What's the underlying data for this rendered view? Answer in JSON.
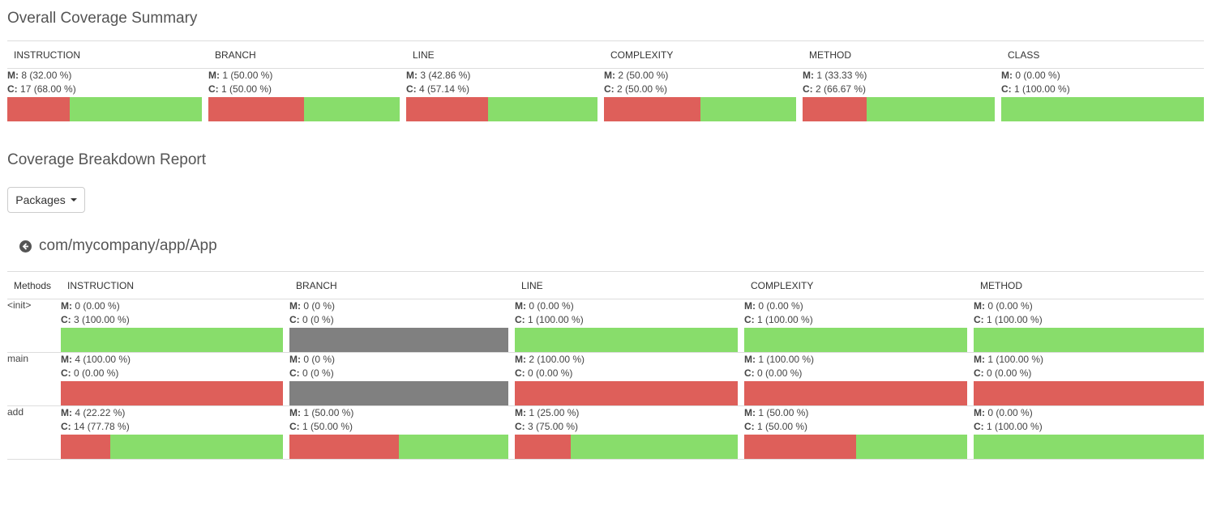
{
  "summary": {
    "title": "Overall Coverage Summary",
    "headers": [
      "INSTRUCTION",
      "BRANCH",
      "LINE",
      "COMPLEXITY",
      "METHOD",
      "CLASS"
    ],
    "cells": [
      {
        "m": "8 (32.00 %)",
        "c": "17 (68.00 %)",
        "missed_fraction": 0.32,
        "empty": false
      },
      {
        "m": "1 (50.00 %)",
        "c": "1 (50.00 %)",
        "missed_fraction": 0.5,
        "empty": false
      },
      {
        "m": "3 (42.86 %)",
        "c": "4 (57.14 %)",
        "missed_fraction": 0.4286,
        "empty": false
      },
      {
        "m": "2 (50.00 %)",
        "c": "2 (50.00 %)",
        "missed_fraction": 0.5,
        "empty": false
      },
      {
        "m": "1 (33.33 %)",
        "c": "2 (66.67 %)",
        "missed_fraction": 0.3333,
        "empty": false
      },
      {
        "m": "0 (0.00 %)",
        "c": "1 (100.00 %)",
        "missed_fraction": 0.0,
        "empty": false
      }
    ]
  },
  "breakdown": {
    "title": "Coverage Breakdown Report",
    "dropdown_label": "Packages",
    "package_name": "com/mycompany/app/App",
    "methods_header": "Methods",
    "headers": [
      "INSTRUCTION",
      "BRANCH",
      "LINE",
      "COMPLEXITY",
      "METHOD"
    ],
    "rows": [
      {
        "name": "<init>",
        "cells": [
          {
            "m": "0 (0.00 %)",
            "c": "3 (100.00 %)",
            "missed_fraction": 0.0,
            "empty": false
          },
          {
            "m": "0 (0 %)",
            "c": "0 (0 %)",
            "missed_fraction": 0.0,
            "empty": true
          },
          {
            "m": "0 (0.00 %)",
            "c": "1 (100.00 %)",
            "missed_fraction": 0.0,
            "empty": false
          },
          {
            "m": "0 (0.00 %)",
            "c": "1 (100.00 %)",
            "missed_fraction": 0.0,
            "empty": false
          },
          {
            "m": "0 (0.00 %)",
            "c": "1 (100.00 %)",
            "missed_fraction": 0.0,
            "empty": false
          }
        ]
      },
      {
        "name": "main",
        "cells": [
          {
            "m": "4 (100.00 %)",
            "c": "0 (0.00 %)",
            "missed_fraction": 1.0,
            "empty": false
          },
          {
            "m": "0 (0 %)",
            "c": "0 (0 %)",
            "missed_fraction": 0.0,
            "empty": true
          },
          {
            "m": "2 (100.00 %)",
            "c": "0 (0.00 %)",
            "missed_fraction": 1.0,
            "empty": false
          },
          {
            "m": "1 (100.00 %)",
            "c": "0 (0.00 %)",
            "missed_fraction": 1.0,
            "empty": false
          },
          {
            "m": "1 (100.00 %)",
            "c": "0 (0.00 %)",
            "missed_fraction": 1.0,
            "empty": false
          }
        ]
      },
      {
        "name": "add",
        "cells": [
          {
            "m": "4 (22.22 %)",
            "c": "14 (77.78 %)",
            "missed_fraction": 0.2222,
            "empty": false
          },
          {
            "m": "1 (50.00 %)",
            "c": "1 (50.00 %)",
            "missed_fraction": 0.5,
            "empty": false
          },
          {
            "m": "1 (25.00 %)",
            "c": "3 (75.00 %)",
            "missed_fraction": 0.25,
            "empty": false
          },
          {
            "m": "1 (50.00 %)",
            "c": "1 (50.00 %)",
            "missed_fraction": 0.5,
            "empty": false
          },
          {
            "m": "0 (0.00 %)",
            "c": "1 (100.00 %)",
            "missed_fraction": 0.0,
            "empty": false
          }
        ]
      }
    ]
  },
  "labels": {
    "missed": "M:",
    "covered": "C:"
  },
  "colors": {
    "missed": "#de5f5a",
    "covered": "#88dd6b",
    "no_data": "#808080"
  }
}
